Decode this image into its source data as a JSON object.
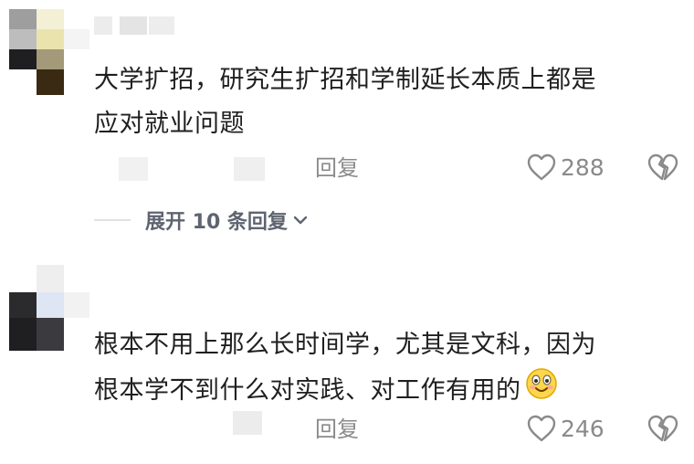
{
  "comments": [
    {
      "text_line1": "大学扩招，研究生扩招和学制延长本质上都是",
      "text_line2": "应对就业问题",
      "reply_label": "回复",
      "like_count": "288"
    },
    {
      "text_line1": "根本不用上那么长时间学，尤其是文科，因为",
      "text_line2": "根本学不到什么对实践、对工作有用的",
      "reply_label": "回复",
      "like_count": "246"
    }
  ],
  "expand_replies": {
    "label": "展开 10 条回复"
  },
  "icons": {
    "like": "heart-icon",
    "dislike": "broken-heart-icon",
    "expand": "chevron-down-icon",
    "emoji": "smiling-emoji-icon"
  }
}
